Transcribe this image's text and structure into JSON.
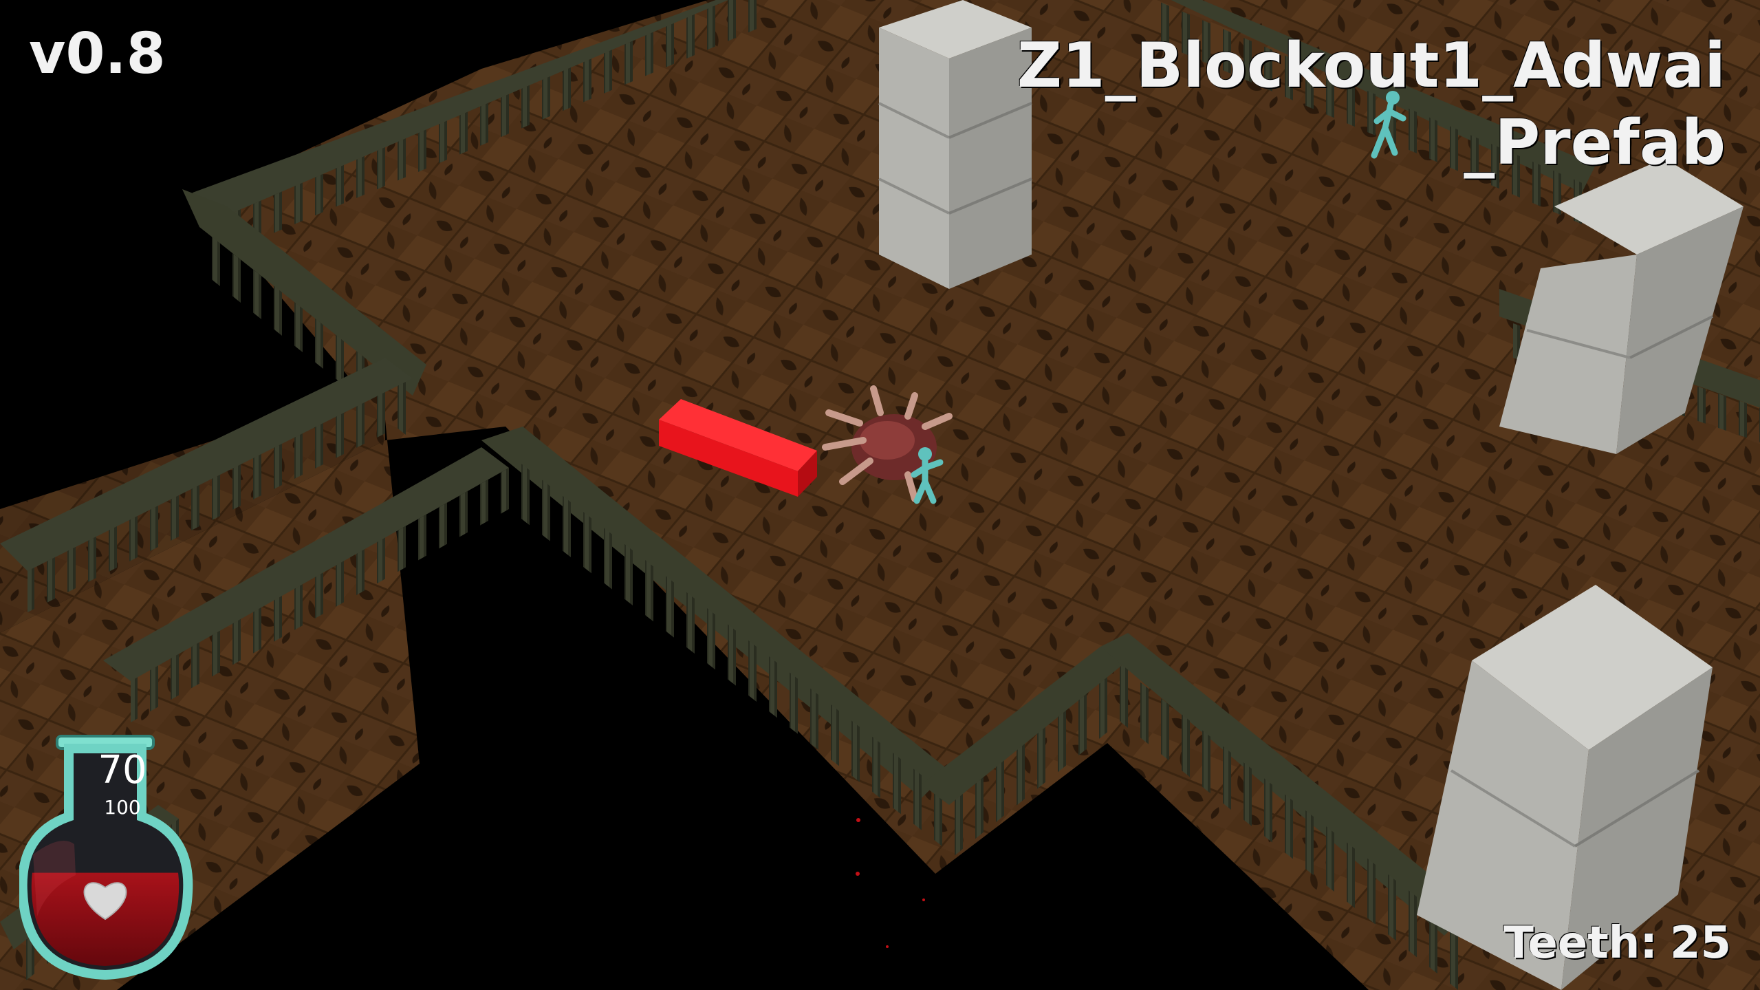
{
  "hud": {
    "version": "v0.8",
    "level_name_line1": "Z1_Blockout1_Adwai",
    "level_name_line2": "_Prefab",
    "teeth_label": "Teeth:",
    "teeth_value": "25"
  },
  "health": {
    "current": "70",
    "max": "100",
    "fraction": 0.7,
    "icon": "heart-icon"
  },
  "colors": {
    "floor": "#4a2e17",
    "floor_dark": "#2b1a0c",
    "railing": "#2f3325",
    "pillar": "#b9b9b4",
    "red_block": "#e8141c",
    "player": "#5fc2bd",
    "potion_glass": "#6fd3c4",
    "potion_liquid": "#8a0b12"
  }
}
